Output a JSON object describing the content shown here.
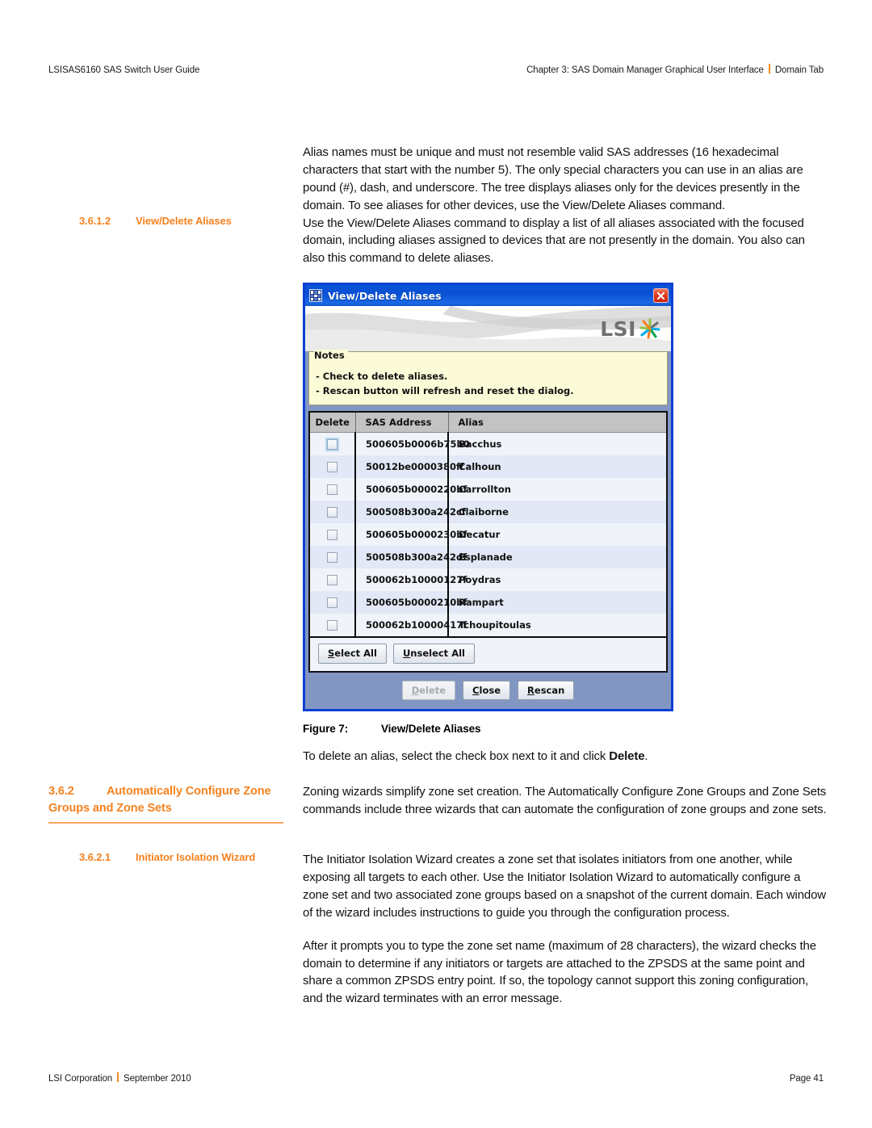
{
  "page": {
    "header_left": "LSISAS6160 SAS Switch User Guide",
    "header_right_chapter": "Chapter 3: SAS Domain Manager Graphical User Interface",
    "header_right_section": "Domain Tab",
    "footer_company": "LSI Corporation",
    "footer_date": "September 2010",
    "footer_page": "Page 41"
  },
  "accent_color": "#f58220",
  "intro_paragraph": "Alias names must be unique and must not resemble valid SAS addresses (16 hexadecimal characters that start with the number 5). The only special characters you can use in an alias are pound (#), dash, and underscore. The tree displays aliases only for the devices presently in the domain. To see aliases for other devices, use the View/Delete Aliases command.",
  "sections": {
    "view_delete_aliases": {
      "number": "3.6.1.2",
      "title": "View/Delete Aliases",
      "paragraph": "Use the View/Delete Aliases command to display a list of all aliases associated with the focused domain, including aliases assigned to devices that are not presently in the domain. You also can also this command to delete aliases."
    },
    "auto_configure": {
      "number": "3.6.2",
      "title": "Automatically Configure Zone Groups and Zone Sets",
      "paragraph": "Zoning wizards simplify zone set creation. The Automatically Configure Zone Groups and Zone Sets commands include three wizards that can automate the configuration of zone groups and zone sets."
    },
    "initiator_wizard": {
      "number": "3.6.2.1",
      "title": "Initiator Isolation Wizard",
      "paragraph_1": "The Initiator Isolation Wizard creates a zone set that isolates initiators from one another, while exposing all targets to each other. Use the Initiator Isolation Wizard to automatically configure a zone set and two associated zone groups based on a snapshot of the current domain. Each window of the wizard includes instructions to guide you through the configuration process.",
      "paragraph_2": "After it prompts you to type the zone set name (maximum of 28 characters), the wizard checks the domain to determine if any initiators or targets are attached to the ZPSDS at the same point and share a common ZPSDS entry point. If so, the topology cannot support this zoning configuration, and the wizard terminates with an error message."
    }
  },
  "figure": {
    "number": "Figure 7:",
    "title": "View/Delete Aliases",
    "after_text_1": "To delete an alias, select the check box next to it and click ",
    "after_text_bold": "Delete",
    "after_text_2": "."
  },
  "dialog": {
    "title": "View/Delete Aliases",
    "title_icon": "application-grid-icon",
    "close_icon": "close-icon",
    "logo_text": "LSI",
    "logo_mark": "lsi-starburst-icon",
    "notes": {
      "legend": "Notes",
      "lines": [
        "- Check to delete aliases.",
        "- Rescan button will refresh and reset the dialog."
      ]
    },
    "table": {
      "columns": [
        "Delete",
        "SAS Address",
        "Alias"
      ],
      "rows": [
        {
          "checked": false,
          "focused": true,
          "sas_address": "500605b0006b75b0",
          "alias": "Bacchus"
        },
        {
          "checked": false,
          "focused": false,
          "sas_address": "50012be0000380ff",
          "alias": "Calhoun"
        },
        {
          "checked": false,
          "focused": false,
          "sas_address": "500605b0000220bf",
          "alias": "Carrollton"
        },
        {
          "checked": false,
          "focused": false,
          "sas_address": "500508b300a242cf",
          "alias": "Claiborne"
        },
        {
          "checked": false,
          "focused": false,
          "sas_address": "500605b0000230bf",
          "alias": "Decatur"
        },
        {
          "checked": false,
          "focused": false,
          "sas_address": "500508b300a242df",
          "alias": "Esplanade"
        },
        {
          "checked": false,
          "focused": false,
          "sas_address": "500062b10000127f",
          "alias": "Poydras"
        },
        {
          "checked": false,
          "focused": false,
          "sas_address": "500605b0000210bf",
          "alias": "Rampart"
        },
        {
          "checked": false,
          "focused": false,
          "sas_address": "500062b10000417f",
          "alias": "Tchoupitoulas"
        }
      ]
    },
    "buttons": {
      "select_all": {
        "mnemonic": "S",
        "rest": "elect All"
      },
      "unselect_all": {
        "mnemonic": "U",
        "rest": "nselect All"
      },
      "delete": {
        "mnemonic": "D",
        "rest": "elete",
        "enabled": false
      },
      "close": {
        "mnemonic": "C",
        "rest": "lose",
        "enabled": true
      },
      "rescan": {
        "mnemonic": "R",
        "rest": "escan",
        "enabled": true
      }
    }
  }
}
